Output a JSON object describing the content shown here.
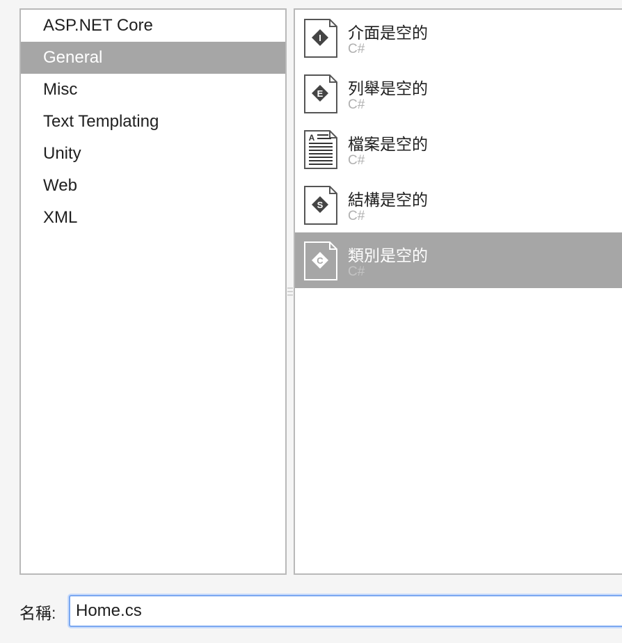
{
  "colors": {
    "selection": "#a6a6a6",
    "focus_border": "#7aa7f0",
    "pane_border": "#b9b9b9"
  },
  "categories": [
    {
      "label": "ASP.NET Core",
      "selected": false
    },
    {
      "label": "General",
      "selected": true
    },
    {
      "label": "Misc",
      "selected": false
    },
    {
      "label": "Text Templating",
      "selected": false
    },
    {
      "label": "Unity",
      "selected": false
    },
    {
      "label": "Web",
      "selected": false
    },
    {
      "label": "XML",
      "selected": false
    }
  ],
  "templates": [
    {
      "title": "介面是空的",
      "subtitle": "C#",
      "icon_letter": "I",
      "icon": "interface-icon",
      "selected": false
    },
    {
      "title": "列舉是空的",
      "subtitle": "C#",
      "icon_letter": "E",
      "icon": "enum-icon",
      "selected": false
    },
    {
      "title": "檔案是空的",
      "subtitle": "C#",
      "icon_letter": "A",
      "icon": "text-file-icon",
      "selected": false
    },
    {
      "title": "結構是空的",
      "subtitle": "C#",
      "icon_letter": "S",
      "icon": "struct-icon",
      "selected": false
    },
    {
      "title": "類別是空的",
      "subtitle": "C#",
      "icon_letter": "C",
      "icon": "class-icon",
      "selected": true
    }
  ],
  "name_field": {
    "label": "名稱:",
    "value": "Home.cs"
  }
}
